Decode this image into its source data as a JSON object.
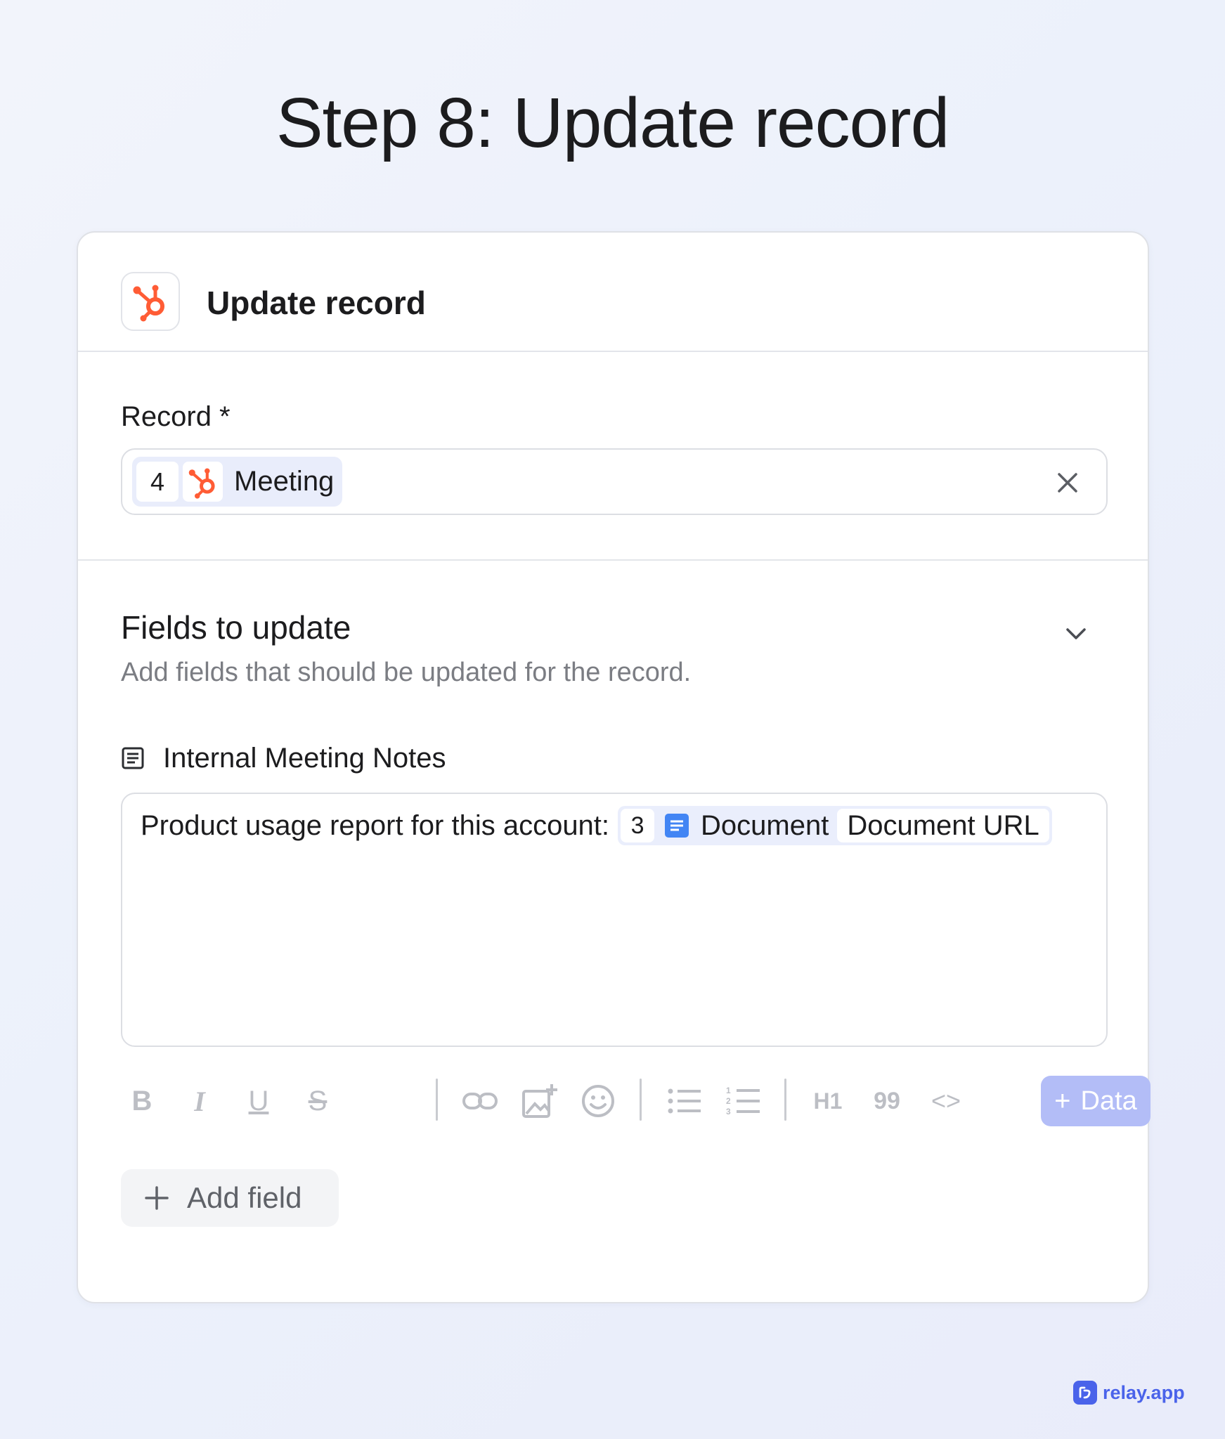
{
  "page": {
    "title": "Step 8: Update record"
  },
  "card": {
    "header_title": "Update record",
    "app_icon": "hubspot-icon"
  },
  "record": {
    "label": "Record *",
    "chip_step": "4",
    "chip_icon": "hubspot-icon",
    "chip_label": "Meeting",
    "clear_icon": "close-icon"
  },
  "fields": {
    "title": "Fields to update",
    "subtitle": "Add fields that should be updated for the record.",
    "toggle_icon": "chevron-down-icon",
    "field_icon": "document-lines-icon",
    "field_label": "Internal Meeting Notes",
    "editor_text": "Product usage report for this account:",
    "chip_step": "3",
    "chip_icon": "google-docs-icon",
    "chip_label": "Document",
    "chip_field": "Document URL"
  },
  "toolbar": {
    "bold_label": "B",
    "italic_label": "I",
    "underline_label": "U",
    "strike_label": "S",
    "heading_label": "H1",
    "quote_label": "99",
    "code_label": "<>",
    "data_button_label": "Data"
  },
  "add_field": {
    "label": "Add field"
  },
  "brand": {
    "name": "relay.app",
    "color": "#4a63ea"
  },
  "colors": {
    "hubspot": "#ff5c35",
    "google_docs": "#4285f4",
    "data_button": "#b3bdf7"
  }
}
